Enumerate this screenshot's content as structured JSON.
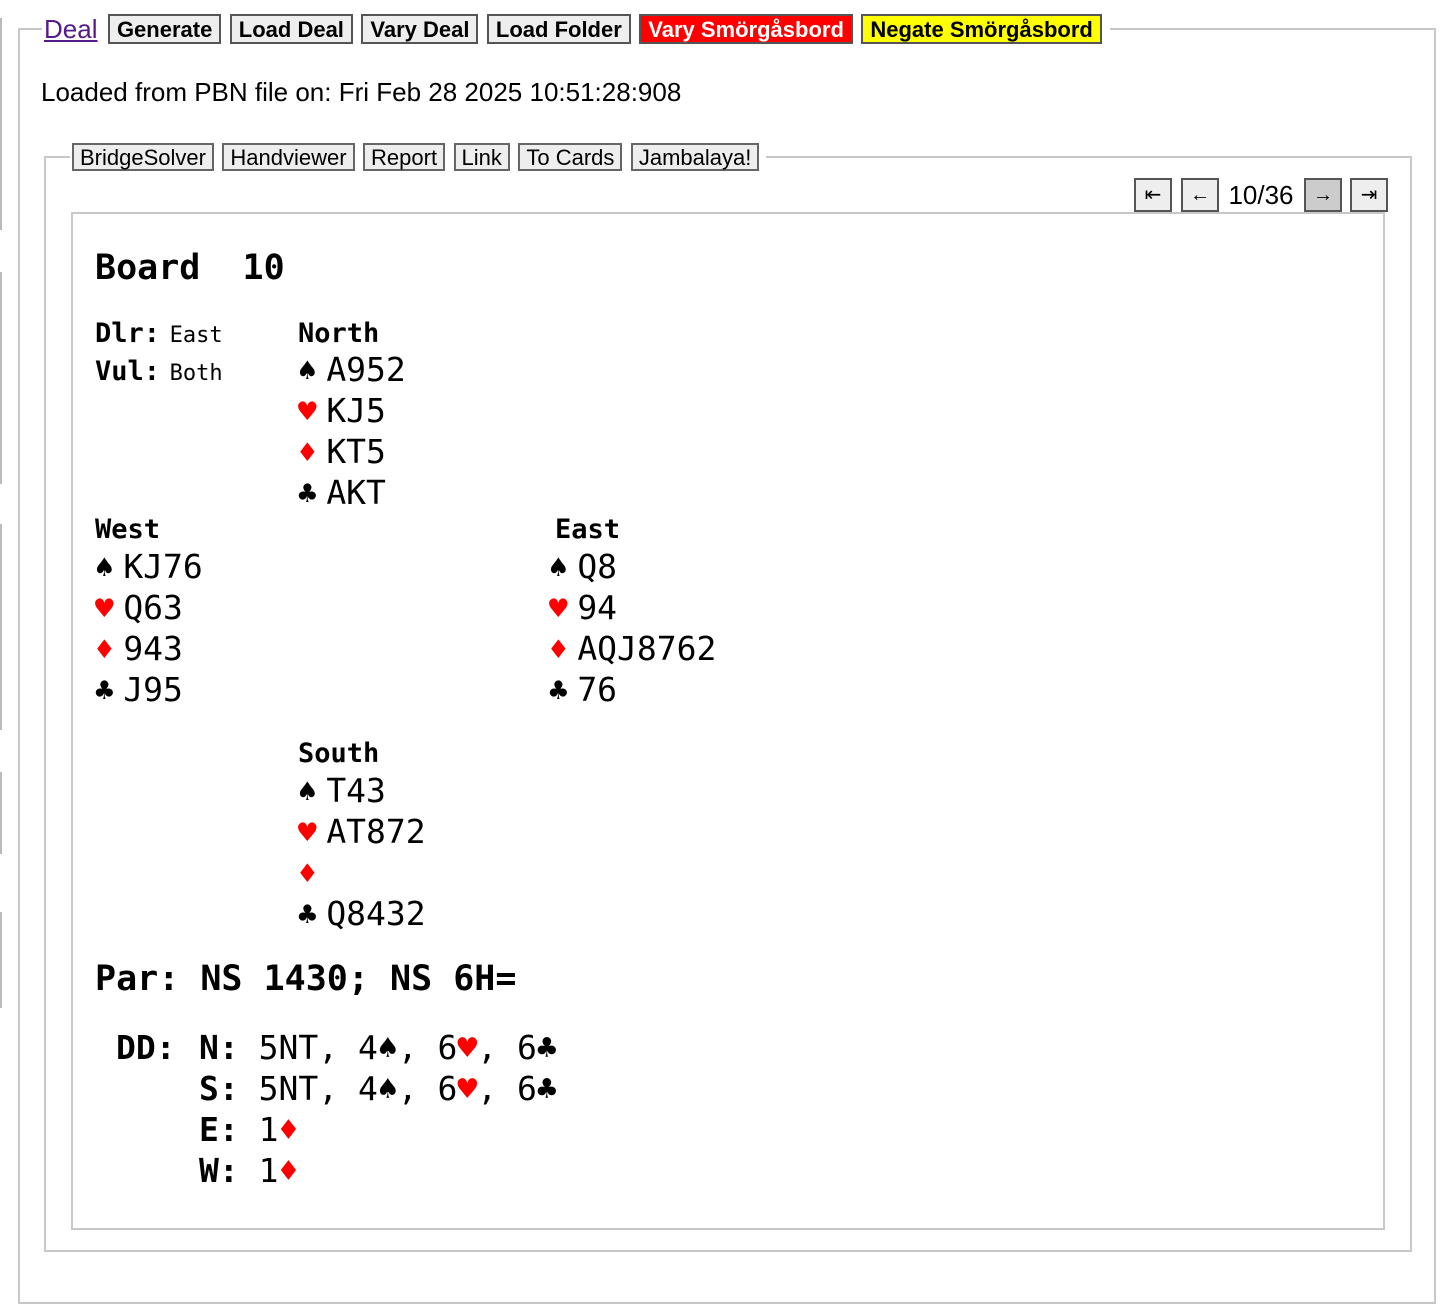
{
  "toolbar": {
    "deal_link": "Deal",
    "buttons": [
      "Generate",
      "Load Deal",
      "Vary Deal",
      "Load Folder",
      "Vary Smörgåsbord",
      "Negate Smörgåsbord"
    ]
  },
  "loaded_text": "Loaded from PBN file on: Fri Feb 28 2025 10:51:28:908",
  "tools": [
    "BridgeSolver",
    "Handviewer",
    "Report",
    "Link",
    "To Cards",
    "Jambalaya!"
  ],
  "nav": {
    "first": "⇤",
    "prev": "←",
    "counter": "10/36",
    "next": "→",
    "last": "⇥"
  },
  "board": {
    "title": "Board  10",
    "dealer_label": "Dlr:",
    "dealer": "East",
    "vul_label": "Vul:",
    "vul": "Both",
    "hands": {
      "north": {
        "name": "North",
        "spades": "A952",
        "hearts": "KJ5",
        "diamonds": "KT5",
        "clubs": "AKT"
      },
      "west": {
        "name": "West",
        "spades": "KJ76",
        "hearts": "Q63",
        "diamonds": "943",
        "clubs": "J95"
      },
      "east": {
        "name": "East",
        "spades": "Q8",
        "hearts": "94",
        "diamonds": "AQJ8762",
        "clubs": "76"
      },
      "south": {
        "name": "South",
        "spades": "T43",
        "hearts": "AT872",
        "diamonds": "",
        "clubs": "Q8432"
      }
    },
    "suit_symbols": {
      "spades": "♠",
      "hearts": "♥",
      "diamonds": "♦",
      "clubs": "♣"
    },
    "par": "Par: NS 1430; NS 6H=",
    "dd_label": "DD:",
    "dd": [
      {
        "seat": "N:",
        "nt": "5NT,",
        "s": "4",
        "h": "6",
        "c": "6"
      },
      {
        "seat": "S:",
        "nt": "5NT,",
        "s": "4",
        "h": "6",
        "c": "6"
      },
      {
        "seat": "E:",
        "d": "1"
      },
      {
        "seat": "W:",
        "d": "1"
      }
    ]
  },
  "colors": {
    "red_button": "#ff0000",
    "yellow_button": "#ffff00",
    "link": "#551a8b",
    "red_suit": "#ff0000"
  }
}
